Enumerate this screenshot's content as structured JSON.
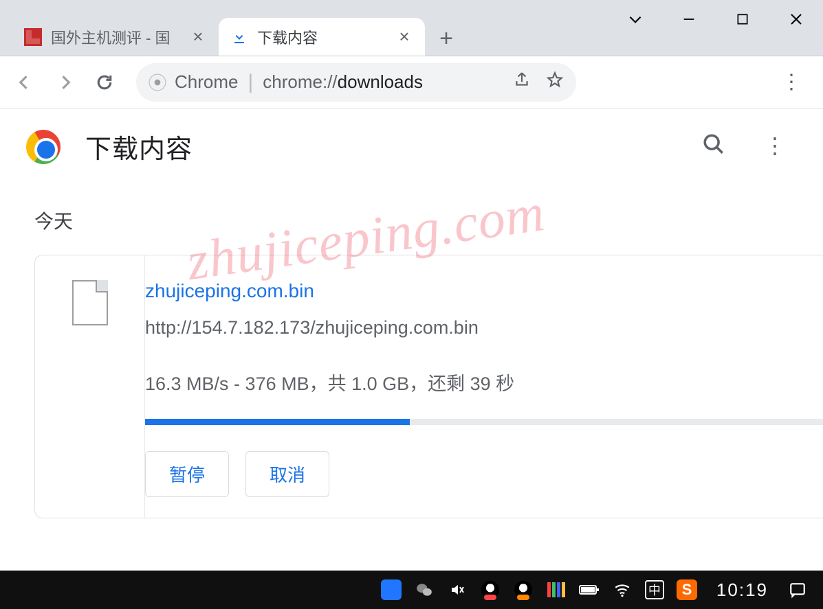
{
  "window": {
    "tabs": [
      {
        "title": "国外主机测评 - 国",
        "active": false
      },
      {
        "title": "下载内容",
        "active": true
      }
    ]
  },
  "omnibox": {
    "scheme_label": "Chrome",
    "url_prefix": "chrome://",
    "url_bold": "downloads"
  },
  "page": {
    "title": "下载内容",
    "date_heading": "今天"
  },
  "download": {
    "filename": "zhujiceping.com.bin",
    "url": "http://154.7.182.173/zhujiceping.com.bin",
    "status": "16.3 MB/s - 376 MB，共 1.0 GB，还剩 39 秒",
    "progress_percent": 39,
    "pause_label": "暂停",
    "cancel_label": "取消"
  },
  "watermark": "zhujiceping.com",
  "taskbar": {
    "ime": "中",
    "clock": "10:19"
  }
}
